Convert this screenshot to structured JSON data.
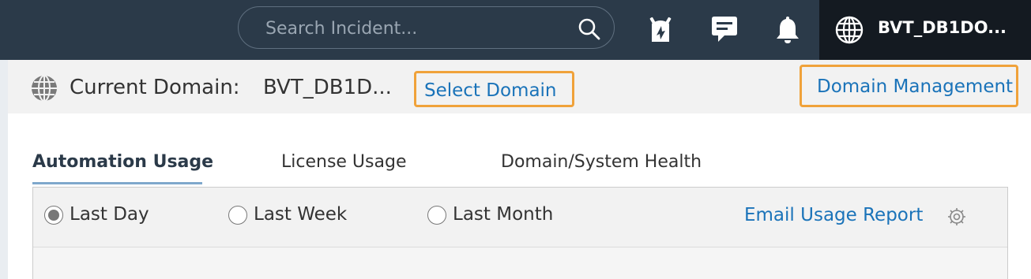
{
  "topbar": {
    "search_placeholder": "Search Incident...",
    "icons": [
      "search-icon",
      "alarm-icon",
      "chat-icon",
      "bell-icon",
      "globe-icon"
    ],
    "domain_name": "BVT_DB1DO..."
  },
  "domain_bar": {
    "current_label": "Current Domain:",
    "current_value": "BVT_DB1D...",
    "select_domain": "Select Domain",
    "domain_management": "Domain Management"
  },
  "tabs": [
    {
      "label": "Automation Usage",
      "active": true
    },
    {
      "label": "License Usage",
      "active": false
    },
    {
      "label": "Domain/System Health",
      "active": false
    }
  ],
  "range": {
    "options": [
      {
        "label": "Last Day",
        "checked": true
      },
      {
        "label": "Last Week",
        "checked": false
      },
      {
        "label": "Last Month",
        "checked": false
      }
    ],
    "email_report": "Email Usage Report"
  },
  "colors": {
    "topbar_bg": "#2b3a49",
    "domain_pill_bg": "#141a21",
    "link": "#1a73b9",
    "highlight_border": "#f0a23a"
  }
}
